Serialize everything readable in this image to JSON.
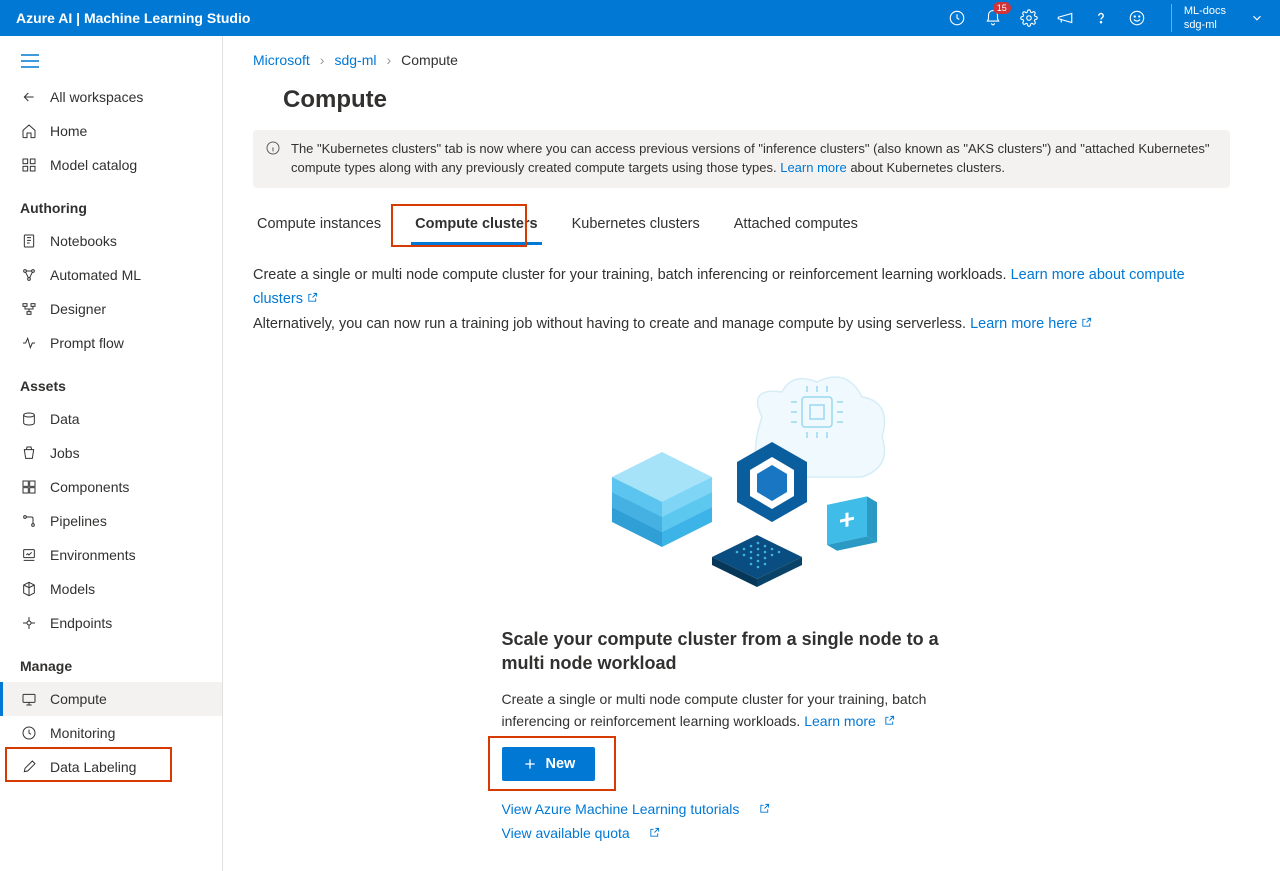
{
  "header": {
    "title": "Azure AI | Machine Learning Studio",
    "notification_count": "15",
    "workspace_name": "ML-docs",
    "workspace_sub": "sdg-ml"
  },
  "sidebar": {
    "all_workspaces": "All workspaces",
    "home": "Home",
    "model_catalog": "Model catalog",
    "section_authoring": "Authoring",
    "notebooks": "Notebooks",
    "automated_ml": "Automated ML",
    "designer": "Designer",
    "prompt_flow": "Prompt flow",
    "section_assets": "Assets",
    "data": "Data",
    "jobs": "Jobs",
    "components": "Components",
    "pipelines": "Pipelines",
    "environments": "Environments",
    "models": "Models",
    "endpoints": "Endpoints",
    "section_manage": "Manage",
    "compute": "Compute",
    "monitoring": "Monitoring",
    "data_labeling": "Data Labeling"
  },
  "breadcrumb": {
    "item0": "Microsoft",
    "item1": "sdg-ml",
    "item2": "Compute"
  },
  "page": {
    "title": "Compute",
    "banner_text": "The \"Kubernetes clusters\" tab is now where you can access previous versions of \"inference clusters\" (also known as \"AKS clusters\") and \"attached Kubernetes\" compute types along with any previously created compute targets using those types. ",
    "banner_link": "Learn more",
    "banner_suffix": " about Kubernetes clusters."
  },
  "tabs": {
    "t0": "Compute instances",
    "t1": "Compute clusters",
    "t2": "Kubernetes clusters",
    "t3": "Attached computes"
  },
  "description": {
    "line1": "Create a single or multi node compute cluster for your training, batch inferencing or reinforcement learning workloads. ",
    "link1": "Learn more about compute clusters",
    "line2": "Alternatively, you can now run a training job without having to create and manage compute by using serverless. ",
    "link2": "Learn more here"
  },
  "empty": {
    "title": "Scale your compute cluster from a single node to a multi node workload",
    "desc": "Create a single or multi node compute cluster for your training, batch inferencing or reinforcement learning workloads. ",
    "desc_link": "Learn more",
    "new_btn": "New",
    "link_tutorials": "View Azure Machine Learning tutorials",
    "link_quota": "View available quota"
  }
}
